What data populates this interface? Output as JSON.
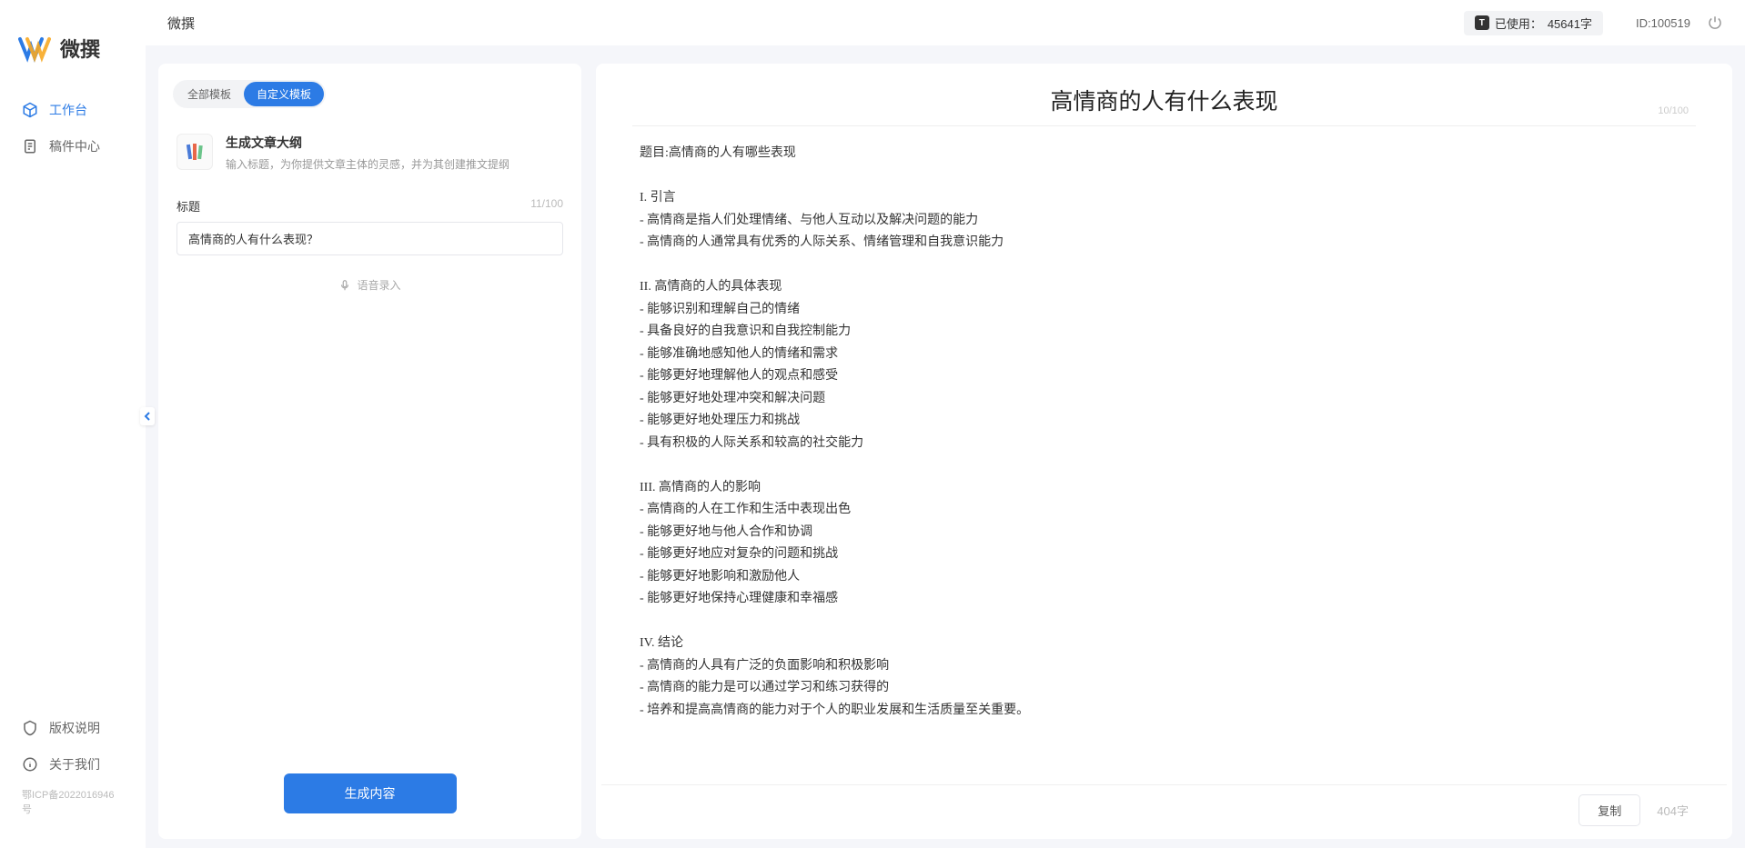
{
  "app": {
    "name": "微撰"
  },
  "sidebar": {
    "nav": [
      {
        "label": "工作台",
        "active": true
      },
      {
        "label": "稿件中心",
        "active": false
      }
    ],
    "footer": [
      {
        "label": "版权说明"
      },
      {
        "label": "关于我们"
      }
    ],
    "icp": "鄂ICP备2022016946号"
  },
  "topbar": {
    "title": "微撰",
    "usage_label": "已使用：",
    "usage_value": "45641字",
    "id_label": "ID:",
    "id_value": "100519"
  },
  "left": {
    "tabs": [
      {
        "label": "全部模板",
        "active": false
      },
      {
        "label": "自定义模板",
        "active": true
      }
    ],
    "template": {
      "name": "生成文章大纲",
      "desc": "输入标题，为你提供文章主体的灵感，并为其创建推文提纲"
    },
    "title_field": {
      "label": "标题",
      "counter": "11/100",
      "value": "高情商的人有什么表现？"
    },
    "voice_label": "语音录入",
    "generate": "生成内容"
  },
  "right": {
    "title": "高情商的人有什么表现",
    "title_counter": "10/100",
    "body": "题目:高情商的人有哪些表现\n\nI. 引言\n- 高情商是指人们处理情绪、与他人互动以及解决问题的能力\n- 高情商的人通常具有优秀的人际关系、情绪管理和自我意识能力\n\nII. 高情商的人的具体表现\n- 能够识别和理解自己的情绪\n- 具备良好的自我意识和自我控制能力\n- 能够准确地感知他人的情绪和需求\n- 能够更好地理解他人的观点和感受\n- 能够更好地处理冲突和解决问题\n- 能够更好地处理压力和挑战\n- 具有积极的人际关系和较高的社交能力\n\nIII. 高情商的人的影响\n- 高情商的人在工作和生活中表现出色\n- 能够更好地与他人合作和协调\n- 能够更好地应对复杂的问题和挑战\n- 能够更好地影响和激励他人\n- 能够更好地保持心理健康和幸福感\n\nIV. 结论\n- 高情商的人具有广泛的负面影响和积极影响\n- 高情商的能力是可以通过学习和练习获得的\n- 培养和提高高情商的能力对于个人的职业发展和生活质量至关重要。",
    "copy": "复制",
    "word_count": "404字"
  }
}
